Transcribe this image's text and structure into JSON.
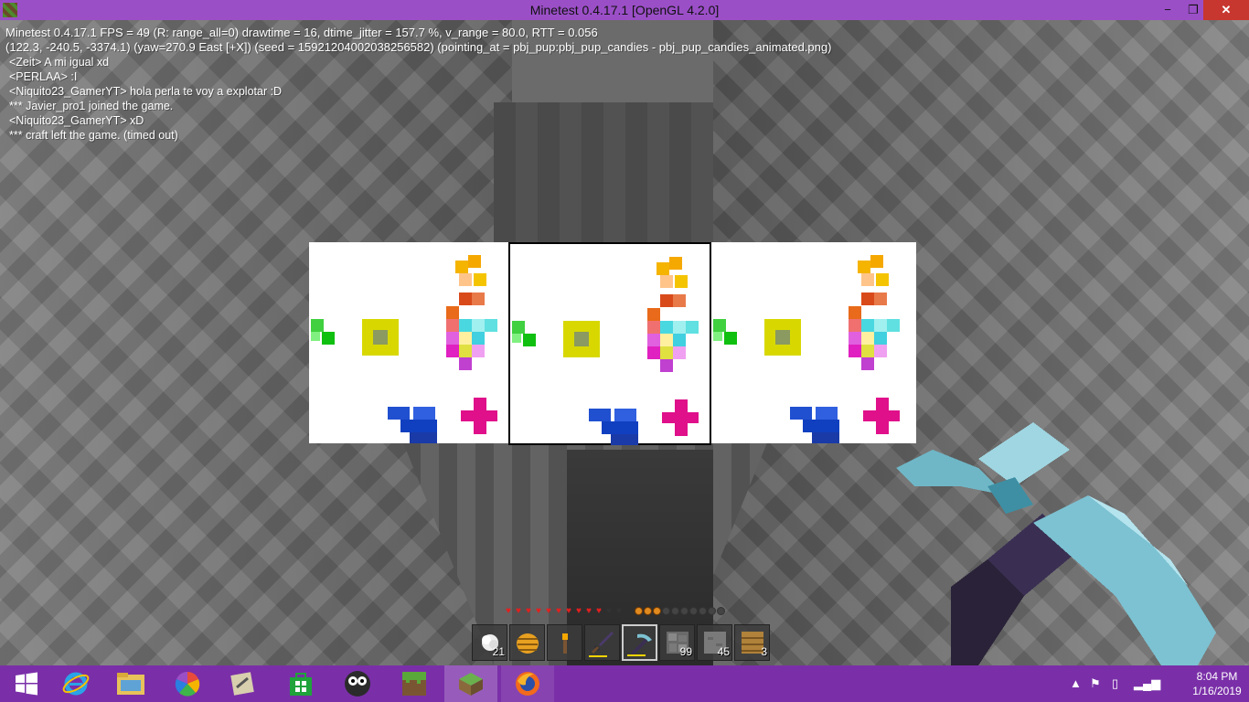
{
  "window": {
    "title": "Minetest 0.4.17.1 [OpenGL 4.2.0]",
    "minimize_glyph": "−",
    "maximize_glyph": "❐",
    "close_glyph": "✕"
  },
  "debug": {
    "line1": "Minetest 0.4.17.1 FPS = 49 (R: range_all=0) drawtime = 16, dtime_jitter = 157.7 %, v_range = 80.0, RTT = 0.056",
    "line2": "(122.3, -240.5, -3374.1) (yaw=270.9 East [+X]) (seed = 15921204002038256582) (pointing_at = pbj_pup:pbj_pup_candies - pbj_pup_candies_animated.png)"
  },
  "chat": [
    "<Zeit> A mi igual xd",
    "<PERLAA> :I",
    "<Niquito23_GamerYT> hola perla te voy a explotar :D",
    "*** Javier_pro1 joined the game.",
    "<Niquito23_GamerYT> xD",
    "*** craft left the game. (timed out)"
  ],
  "hud": {
    "hearts_full": 10,
    "hearts_total": 12,
    "breath_full": 3,
    "breath_total": 10
  },
  "hotbar": [
    {
      "item": "cotton-icon",
      "count": "21"
    },
    {
      "item": "beehive-icon",
      "count": ""
    },
    {
      "item": "torch-icon",
      "count": ""
    },
    {
      "item": "sword-icon",
      "count": ""
    },
    {
      "item": "pickaxe-icon",
      "count": "",
      "selected": true
    },
    {
      "item": "cobblestone-icon",
      "count": "99"
    },
    {
      "item": "stone-icon",
      "count": "45"
    },
    {
      "item": "wood-planks-icon",
      "count": "3"
    }
  ],
  "taskbar": {
    "apps": [
      "start",
      "internet-explorer",
      "file-explorer",
      "picasa",
      "unknown-tool",
      "store",
      "game-app",
      "minecraft",
      "minetest",
      "firefox"
    ],
    "clock_time": "8:04 PM",
    "clock_date": "1/16/2019"
  },
  "colors": {
    "titlebar": "#9b4fc7",
    "taskbar": "#7a2fa8",
    "close_button": "#c7372f"
  }
}
